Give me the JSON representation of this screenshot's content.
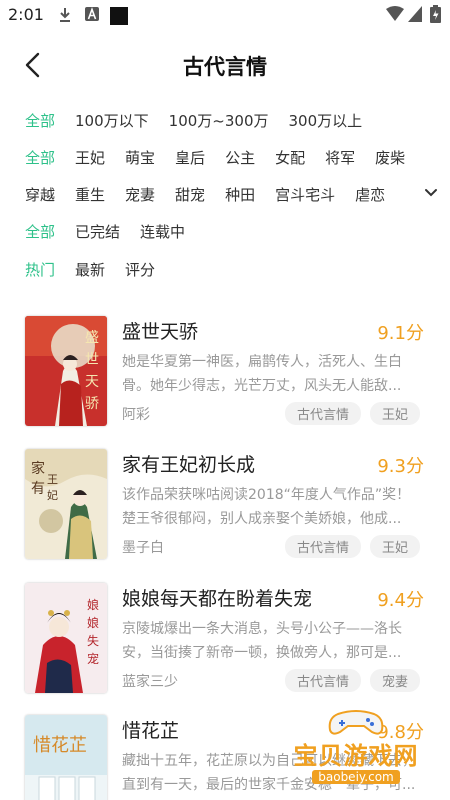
{
  "status_bar": {
    "time": "2:01"
  },
  "header": {
    "title": "古代言情"
  },
  "filters": {
    "word_count": [
      "全部",
      "100万以下",
      "100万~300万",
      "300万以上"
    ],
    "category_row1": [
      "全部",
      "王妃",
      "萌宝",
      "皇后",
      "公主",
      "女配",
      "将军",
      "废柴"
    ],
    "category_row2": [
      "穿越",
      "重生",
      "宠妻",
      "甜宠",
      "种田",
      "宫斗宅斗",
      "虐恋"
    ],
    "status": [
      "全部",
      "已完结",
      "连载中"
    ],
    "sort": [
      "热门",
      "最新",
      "评分"
    ]
  },
  "colors": {
    "accent": "#2ec18a",
    "score": "#f0a020"
  },
  "books": [
    {
      "title": "盛世天骄",
      "score": "9.1分",
      "desc": "她是华夏第一神医，扁鹊传人，活死人、生白骨。她年少得志，光芒万丈，风头无人能敌...",
      "author": "阿彩",
      "tags": [
        "古代言情",
        "王妃"
      ]
    },
    {
      "title": "家有王妃初长成",
      "score": "9.3分",
      "desc": "该作品荣获咪咕阅读2018“年度人气作品”奖！楚王爷很郁闷，别人成亲娶个美娇娘，他成...",
      "author": "墨子白",
      "tags": [
        "古代言情",
        "王妃"
      ]
    },
    {
      "title": "娘娘每天都在盼着失宠",
      "score": "9.4分",
      "desc": "京陵城爆出一条大消息，头号小公子——洛长安，当街揍了新帝一顿，换做旁人，那可是...",
      "author": "蓝家三少",
      "tags": [
        "古代言情",
        "宠妻"
      ]
    },
    {
      "title": "惜花芷",
      "score": "9.8分",
      "desc": "藏拙十五年，花芷原以为自己可以继续藏下去，直到有一天，最后的世家千金安稳一辈子，可...",
      "author": "",
      "tags": []
    }
  ],
  "watermark": {
    "text": "宝贝游戏网",
    "url": "baobeiy.com"
  }
}
